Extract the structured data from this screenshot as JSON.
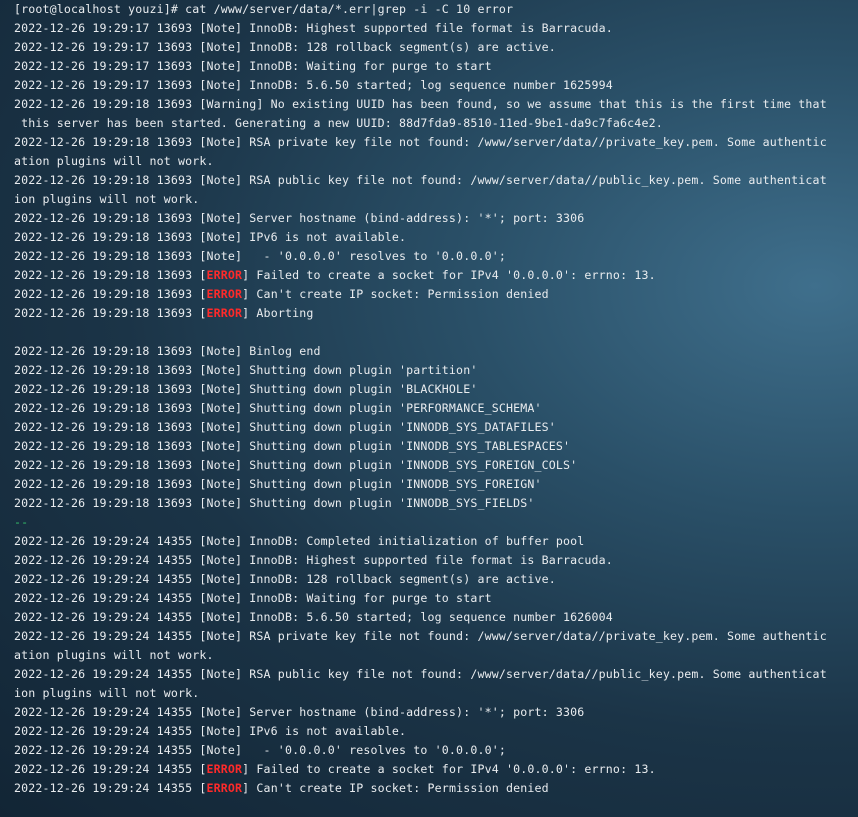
{
  "terminal": {
    "lines": [
      {
        "type": "plain",
        "text": "[root@localhost youzi]# cat /www/server/data/*.err|grep -i -C 10 error"
      },
      {
        "type": "plain",
        "text": "2022-12-26 19:29:17 13693 [Note] InnoDB: Highest supported file format is Barracuda."
      },
      {
        "type": "plain",
        "text": "2022-12-26 19:29:17 13693 [Note] InnoDB: 128 rollback segment(s) are active."
      },
      {
        "type": "plain",
        "text": "2022-12-26 19:29:17 13693 [Note] InnoDB: Waiting for purge to start"
      },
      {
        "type": "plain",
        "text": "2022-12-26 19:29:17 13693 [Note] InnoDB: 5.6.50 started; log sequence number 1625994"
      },
      {
        "type": "plain",
        "text": "2022-12-26 19:29:18 13693 [Warning] No existing UUID has been found, so we assume that this is the first time that"
      },
      {
        "type": "plain",
        "text": " this server has been started. Generating a new UUID: 88d7fda9-8510-11ed-9be1-da9c7fa6c4e2."
      },
      {
        "type": "plain",
        "text": "2022-12-26 19:29:18 13693 [Note] RSA private key file not found: /www/server/data//private_key.pem. Some authentic"
      },
      {
        "type": "plain",
        "text": "ation plugins will not work."
      },
      {
        "type": "plain",
        "text": "2022-12-26 19:29:18 13693 [Note] RSA public key file not found: /www/server/data//public_key.pem. Some authenticat"
      },
      {
        "type": "plain",
        "text": "ion plugins will not work."
      },
      {
        "type": "plain",
        "text": "2022-12-26 19:29:18 13693 [Note] Server hostname (bind-address): '*'; port: 3306"
      },
      {
        "type": "plain",
        "text": "2022-12-26 19:29:18 13693 [Note] IPv6 is not available."
      },
      {
        "type": "plain",
        "text": "2022-12-26 19:29:18 13693 [Note]   - '0.0.0.0' resolves to '0.0.0.0';"
      },
      {
        "type": "error",
        "prefix": "2022-12-26 19:29:18 13693 [",
        "keyword": "ERROR",
        "suffix": "] Failed to create a socket for IPv4 '0.0.0.0': errno: 13."
      },
      {
        "type": "error",
        "prefix": "2022-12-26 19:29:18 13693 [",
        "keyword": "ERROR",
        "suffix": "] Can't create IP socket: Permission denied"
      },
      {
        "type": "error",
        "prefix": "2022-12-26 19:29:18 13693 [",
        "keyword": "ERROR",
        "suffix": "] Aborting"
      },
      {
        "type": "blank",
        "text": ""
      },
      {
        "type": "plain",
        "text": "2022-12-26 19:29:18 13693 [Note] Binlog end"
      },
      {
        "type": "plain",
        "text": "2022-12-26 19:29:18 13693 [Note] Shutting down plugin 'partition'"
      },
      {
        "type": "plain",
        "text": "2022-12-26 19:29:18 13693 [Note] Shutting down plugin 'BLACKHOLE'"
      },
      {
        "type": "plain",
        "text": "2022-12-26 19:29:18 13693 [Note] Shutting down plugin 'PERFORMANCE_SCHEMA'"
      },
      {
        "type": "plain",
        "text": "2022-12-26 19:29:18 13693 [Note] Shutting down plugin 'INNODB_SYS_DATAFILES'"
      },
      {
        "type": "plain",
        "text": "2022-12-26 19:29:18 13693 [Note] Shutting down plugin 'INNODB_SYS_TABLESPACES'"
      },
      {
        "type": "plain",
        "text": "2022-12-26 19:29:18 13693 [Note] Shutting down plugin 'INNODB_SYS_FOREIGN_COLS'"
      },
      {
        "type": "plain",
        "text": "2022-12-26 19:29:18 13693 [Note] Shutting down plugin 'INNODB_SYS_FOREIGN'"
      },
      {
        "type": "plain",
        "text": "2022-12-26 19:29:18 13693 [Note] Shutting down plugin 'INNODB_SYS_FIELDS'"
      },
      {
        "type": "separator",
        "text": "--"
      },
      {
        "type": "plain",
        "text": "2022-12-26 19:29:24 14355 [Note] InnoDB: Completed initialization of buffer pool"
      },
      {
        "type": "plain",
        "text": "2022-12-26 19:29:24 14355 [Note] InnoDB: Highest supported file format is Barracuda."
      },
      {
        "type": "plain",
        "text": "2022-12-26 19:29:24 14355 [Note] InnoDB: 128 rollback segment(s) are active."
      },
      {
        "type": "plain",
        "text": "2022-12-26 19:29:24 14355 [Note] InnoDB: Waiting for purge to start"
      },
      {
        "type": "plain",
        "text": "2022-12-26 19:29:24 14355 [Note] InnoDB: 5.6.50 started; log sequence number 1626004"
      },
      {
        "type": "plain",
        "text": "2022-12-26 19:29:24 14355 [Note] RSA private key file not found: /www/server/data//private_key.pem. Some authentic"
      },
      {
        "type": "plain",
        "text": "ation plugins will not work."
      },
      {
        "type": "plain",
        "text": "2022-12-26 19:29:24 14355 [Note] RSA public key file not found: /www/server/data//public_key.pem. Some authenticat"
      },
      {
        "type": "plain",
        "text": "ion plugins will not work."
      },
      {
        "type": "plain",
        "text": "2022-12-26 19:29:24 14355 [Note] Server hostname (bind-address): '*'; port: 3306"
      },
      {
        "type": "plain",
        "text": "2022-12-26 19:29:24 14355 [Note] IPv6 is not available."
      },
      {
        "type": "plain",
        "text": "2022-12-26 19:29:24 14355 [Note]   - '0.0.0.0' resolves to '0.0.0.0';"
      },
      {
        "type": "error",
        "prefix": "2022-12-26 19:29:24 14355 [",
        "keyword": "ERROR",
        "suffix": "] Failed to create a socket for IPv4 '0.0.0.0': errno: 13."
      },
      {
        "type": "error",
        "prefix": "2022-12-26 19:29:24 14355 [",
        "keyword": "ERROR",
        "suffix": "] Can't create IP socket: Permission denied"
      }
    ]
  },
  "colors": {
    "text": "#e9ecef",
    "error_keyword": "#ff2a2a",
    "separator": "#35c26a",
    "background": "#1b3447"
  }
}
